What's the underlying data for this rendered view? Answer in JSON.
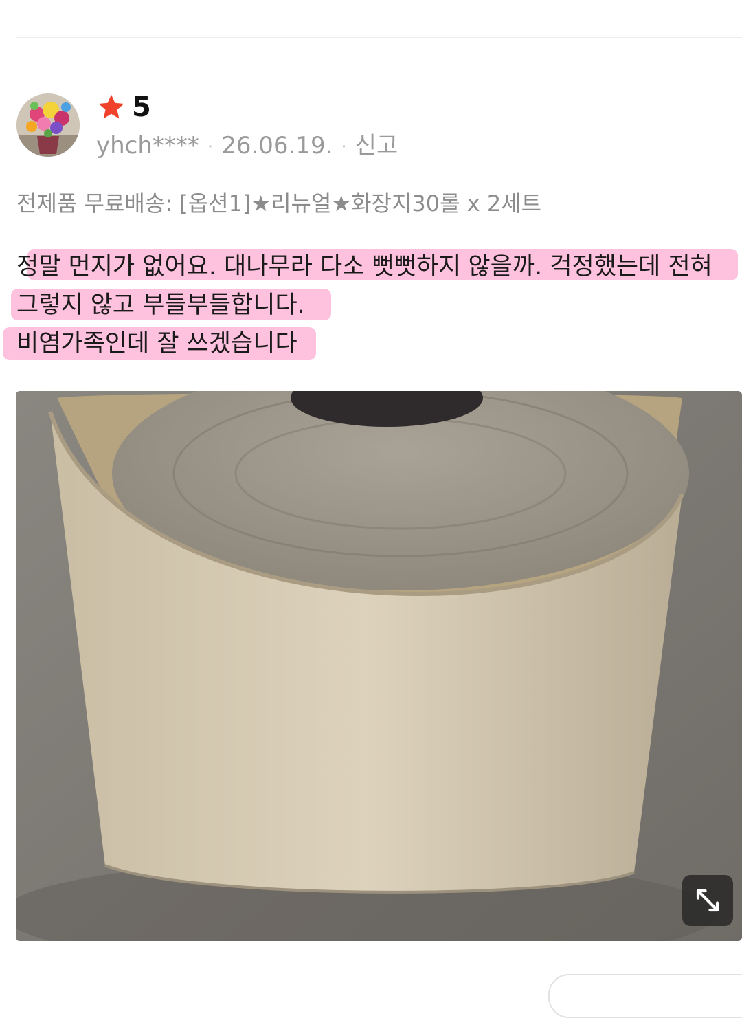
{
  "review": {
    "rating": "5",
    "username": "yhch****",
    "date": "26.06.19.",
    "report_label": "신고",
    "separator": "·",
    "option_text": "전제품 무료배송: [옵션1]★리뉴얼★화장지30롤 x 2세트",
    "body_lines": [
      "정말 먼지가 없어요. 대나무라 다소 뻣뻣하지 않을까. 걱정했는데 전혀",
      "그렇지 않고 부들부들합니다.",
      "비염가족인데 잘 쓰겠습니다"
    ]
  },
  "icons": {
    "star": "star-icon",
    "expand": "expand-icon",
    "avatar": "flower-bouquet-avatar"
  },
  "colors": {
    "star": "#f0412a",
    "highlight": "#ff8fc2",
    "meta_text": "#9a9a9a"
  }
}
